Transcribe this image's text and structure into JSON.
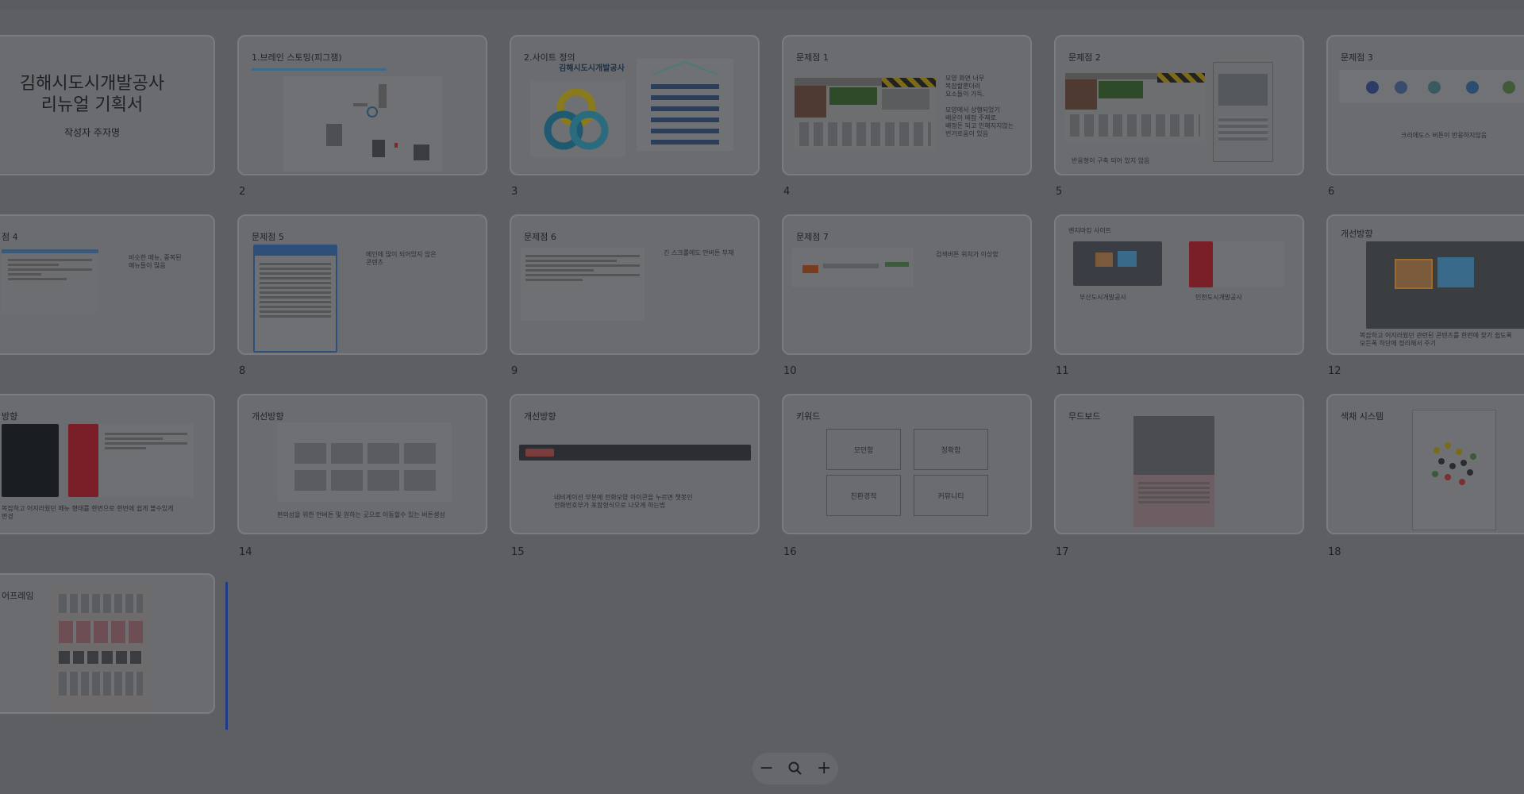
{
  "slides": [
    {
      "num": "",
      "title": "",
      "main_title": "김해시도시개발공사\n리뉴얼 기획서",
      "author": "작성자 주자명"
    },
    {
      "num": "2",
      "title": "1.브레인 스토밍(피그잼)"
    },
    {
      "num": "3",
      "title": "2.사이트 정의",
      "logo_text": "김해시도시개발공사"
    },
    {
      "num": "4",
      "title": "문제점 1",
      "caption": "모양 화면 너무\n복잡할뿐더러\n요소들이 가득.\n\n모양에서 상행되었기\n배운이 배잡 주제로\n배정돈 되고 인해지지않는\n번거로움이 있음"
    },
    {
      "num": "5",
      "title": "문제점 2",
      "caption": "반응형이 구축 되어 있지 않음"
    },
    {
      "num": "6",
      "title": "문제점 3",
      "caption": "크리에도스 버튼이 반응하지않음"
    },
    {
      "num": "",
      "title": "점 4",
      "caption": "비슷한 메뉴, 중복된\n메뉴들이 많음"
    },
    {
      "num": "8",
      "title": "문제점 5",
      "caption": "메인에 많이 되어있지 않은\n콘텐츠"
    },
    {
      "num": "9",
      "title": "문제점 6",
      "caption": "긴 스크롤에도 안버튼 부재"
    },
    {
      "num": "10",
      "title": "문제점 7",
      "caption": "검색버튼 위치가 이상함"
    },
    {
      "num": "11",
      "title": "",
      "top_label": "벤치마킹 사이트",
      "caption_left": "부산도시개발공사",
      "caption_right": "인천도시개발공사"
    },
    {
      "num": "12",
      "title": "개선방향",
      "caption": "복잡하고 어지러웠던 관련된 콘텐츠를 한번에 찾기 쉽도록\n모든폭 하단에 정리해서 주기"
    },
    {
      "num": "",
      "title": "방향",
      "caption": "복잡하고 어지러웠던 메뉴 형태를 한번으로 한번에 쉽게 볼수있게\n변경"
    },
    {
      "num": "14",
      "title": "개선방향",
      "caption": "편의성을 위한 안버튼 및 원하는 곳으로 이동할수 있는 버튼생성"
    },
    {
      "num": "15",
      "title": "개선방향",
      "caption": "네비게이션 부분에 전화모양 아이콘을 누르면 챗봇인\n전화번호부가 포함형식으로 나오게 하는법"
    },
    {
      "num": "16",
      "title": "키워드",
      "keywords": [
        "모던함",
        "정확함",
        "친환경적",
        "커뮤니티"
      ]
    },
    {
      "num": "17",
      "title": "무드보드"
    },
    {
      "num": "18",
      "title": "색채 시스템"
    },
    {
      "num": "",
      "title": "어프레임"
    }
  ],
  "zoom": {
    "minus": "−",
    "plus": "+"
  }
}
